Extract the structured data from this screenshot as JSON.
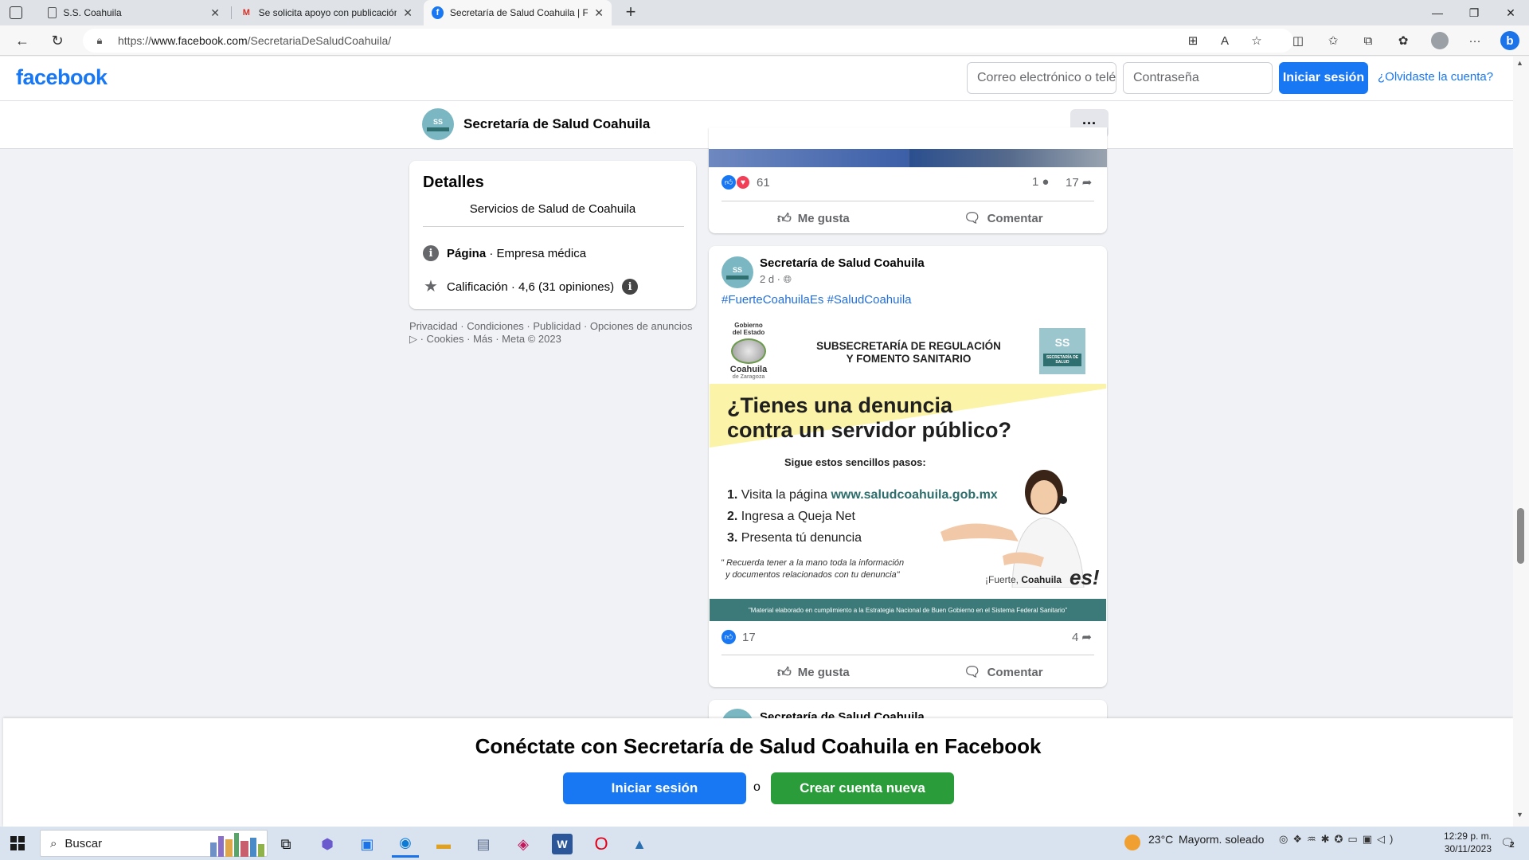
{
  "browser": {
    "tabs": [
      {
        "label": "S.S. Coahuila",
        "icon": "page-icon"
      },
      {
        "label": "Se solicita apoyo con publicación",
        "icon": "gmail-icon"
      },
      {
        "label": "Secretaría de Salud Coahuila | Facebook",
        "icon": "facebook-icon"
      }
    ],
    "url_prefix": "https://",
    "url_host": "www.facebook.com",
    "url_path": "/SecretariaDeSaludCoahuila/"
  },
  "header": {
    "logo": "facebook",
    "email_placeholder": "Correo electrónico o teléfono",
    "password_placeholder": "Contraseña",
    "login_label": "Iniciar sesión",
    "forgot_label": "¿Olvidaste la cuenta?"
  },
  "page": {
    "name": "Secretaría de Salud Coahuila",
    "avatar_text": "SS"
  },
  "details": {
    "title": "Detalles",
    "subtitle": "Servicios de Salud de Coahuila",
    "type_bold": "Página",
    "type_rest": " · Empresa médica",
    "rating": "Calificación · 4,6 (31 opiniones)"
  },
  "footer": {
    "line1": "Privacidad · Condiciones · Publicidad · Opciones de anuncios",
    "line2": " · Cookies · Más · Meta © 2023"
  },
  "post1": {
    "reactions": "61",
    "comments": "1",
    "shares": "17",
    "like_label": "Me gusta",
    "comment_label": "Comentar"
  },
  "post2": {
    "author": "Secretaría de Salud Coahuila",
    "time": "2 d · ",
    "hashtags": "#FuerteCoahuilaEs #SaludCoahuila",
    "reactions": "17",
    "shares": "4",
    "like_label": "Me gusta",
    "comment_label": "Comentar",
    "graphic": {
      "gov_line1": "Gobierno",
      "gov_line2": "del Estado",
      "gov_line3": "Coahuila",
      "gov_line4": "de Zaragoza",
      "dept_line1": "SUBSECRETARÍA DE REGULACIÓN",
      "dept_line2": "Y FOMENTO SANITARIO",
      "ss_badge": "SS",
      "ss_badge_sub": "SECRETARÍA DE SALUD",
      "headline1": "¿Tienes una denuncia",
      "headline2": "contra un servidor público?",
      "steps_intro": "Sigue estos sencillos pasos:",
      "step1_num": "1.",
      "step1_text": "Visita la página ",
      "step1_link": "www.saludcoahuila.gob.mx",
      "step2_num": "2.",
      "step2_text": "Ingresa a Queja Net",
      "step3_num": "3.",
      "step3_text": "Presenta tú denuncia",
      "note1": "\" Recuerda tener a la mano toda la información",
      "note2": "y documentos relacionados con tu denuncia\"",
      "brand1": "¡Fuerte,",
      "brand2": "Coahuila",
      "brand3": "es!",
      "footer_strip": "\"Material elaborado en cumplimiento a la Estrategia Nacional de Buen Gobierno en el Sistema Federal Sanitario\""
    }
  },
  "post3": {
    "author": "Secretaría de Salud Coahuila"
  },
  "banner": {
    "title": "Conéctate con Secretaría de Salud Coahuila en Facebook",
    "login_label": "Iniciar sesión",
    "or_label": "o",
    "create_label": "Crear cuenta nueva"
  },
  "taskbar": {
    "search_label": "Buscar",
    "weather_temp": "23°C",
    "weather_desc": "Mayorm. soleado",
    "time": "12:29 p. m.",
    "date": "30/11/2023",
    "notif_count": "2"
  },
  "colors": {
    "fb_blue": "#1877f2",
    "create_green": "#2a9d3a",
    "teal": "#3b7a78"
  }
}
